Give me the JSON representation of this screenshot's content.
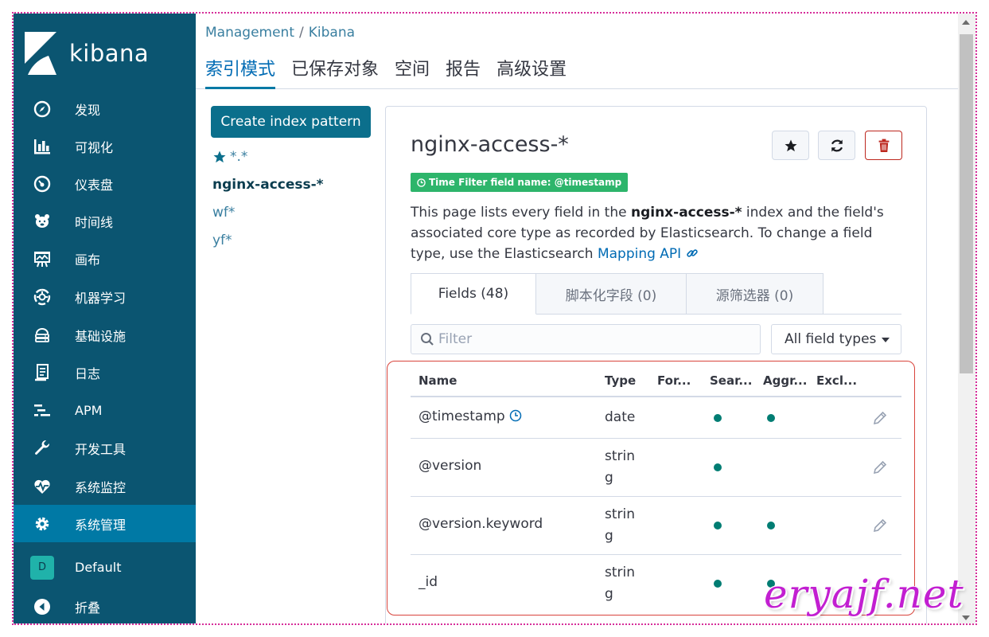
{
  "app": {
    "name": "kibana"
  },
  "sidebar": {
    "items": [
      {
        "label": "发现",
        "icon": "compass-icon"
      },
      {
        "label": "可视化",
        "icon": "bar-chart-icon"
      },
      {
        "label": "仪表盘",
        "icon": "dashboard-icon"
      },
      {
        "label": "时间线",
        "icon": "timeline-bear-icon"
      },
      {
        "label": "画布",
        "icon": "canvas-icon"
      },
      {
        "label": "机器学习",
        "icon": "machine-learning-icon"
      },
      {
        "label": "基础设施",
        "icon": "infrastructure-icon"
      },
      {
        "label": "日志",
        "icon": "logs-icon"
      },
      {
        "label": "APM",
        "icon": "apm-icon"
      },
      {
        "label": "开发工具",
        "icon": "wrench-icon"
      },
      {
        "label": "系统监控",
        "icon": "heartbeat-icon"
      },
      {
        "label": "系统管理",
        "icon": "gear-icon",
        "active": true
      }
    ],
    "space": {
      "badge": "D",
      "label": "Default"
    },
    "collapse": {
      "label": "折叠",
      "icon": "collapse-icon"
    }
  },
  "header": {
    "breadcrumb": [
      "Management",
      "Kibana"
    ],
    "tabs": [
      {
        "label": "索引模式",
        "active": true
      },
      {
        "label": "已保存对象"
      },
      {
        "label": "空间"
      },
      {
        "label": "报告"
      },
      {
        "label": "高级设置"
      }
    ]
  },
  "left": {
    "create_label": "Create index pattern",
    "patterns": [
      {
        "label": "*.*",
        "default": true
      },
      {
        "label": "nginx-access-*",
        "selected": true
      },
      {
        "label": "wf*"
      },
      {
        "label": "yf*"
      }
    ]
  },
  "detail": {
    "title": "nginx-access-*",
    "time_badge": "Time Filter field name: @timestamp",
    "desc_1": "This page lists every field in the ",
    "desc_bold": "nginx-access-*",
    "desc_2": " index and the field's associated core type as recorded by Elasticsearch. To change a field type, use the Elasticsearch ",
    "desc_link": "Mapping API",
    "tabs": [
      {
        "label": "Fields (48)",
        "active": true
      },
      {
        "label": "脚本化字段 (0)"
      },
      {
        "label": "源筛选器 (0)"
      }
    ],
    "filter_placeholder": "Filter",
    "type_select": "All field types",
    "columns": [
      "Name",
      "Type",
      "For...",
      "Sear...",
      "Aggr...",
      "Excl..."
    ],
    "rows": [
      {
        "name": "@timestamp",
        "type": "date",
        "searchable": true,
        "aggregatable": true,
        "time_field": true
      },
      {
        "name": "@version",
        "type": "string",
        "searchable": true,
        "aggregatable": false
      },
      {
        "name": "@version.keyword",
        "type": "string",
        "searchable": true,
        "aggregatable": true
      },
      {
        "name": "_id",
        "type": "string",
        "searchable": true,
        "aggregatable": true
      }
    ]
  },
  "colors": {
    "sidebar": "#0b5571",
    "active_nav": "#0079a5",
    "accent": "#006bb4",
    "success": "#2db56b",
    "danger": "#bd271e",
    "dot": "#017d73"
  },
  "watermark": "eryajf.net"
}
